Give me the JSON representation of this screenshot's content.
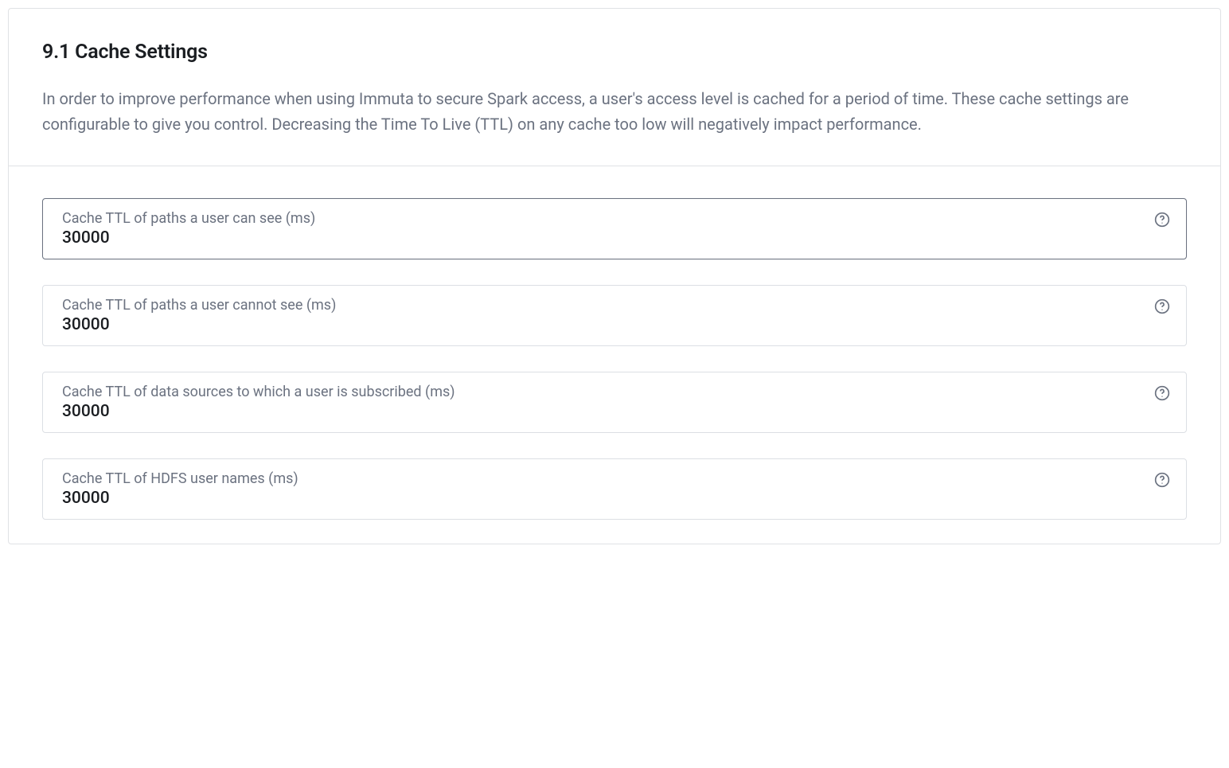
{
  "section": {
    "title": "9.1 Cache Settings",
    "description": "In order to improve performance when using Immuta to secure Spark access, a user's access level is cached for a period of time. These cache settings are configurable to give you control. Decreasing the Time To Live (TTL) on any cache too low will negatively impact performance."
  },
  "fields": [
    {
      "label": "Cache TTL of paths a user can see (ms)",
      "value": "30000",
      "focused": true
    },
    {
      "label": "Cache TTL of paths a user cannot see (ms)",
      "value": "30000",
      "focused": false
    },
    {
      "label": "Cache TTL of data sources to which a user is subscribed (ms)",
      "value": "30000",
      "focused": false
    },
    {
      "label": "Cache TTL of HDFS user names (ms)",
      "value": "30000",
      "focused": false
    }
  ]
}
